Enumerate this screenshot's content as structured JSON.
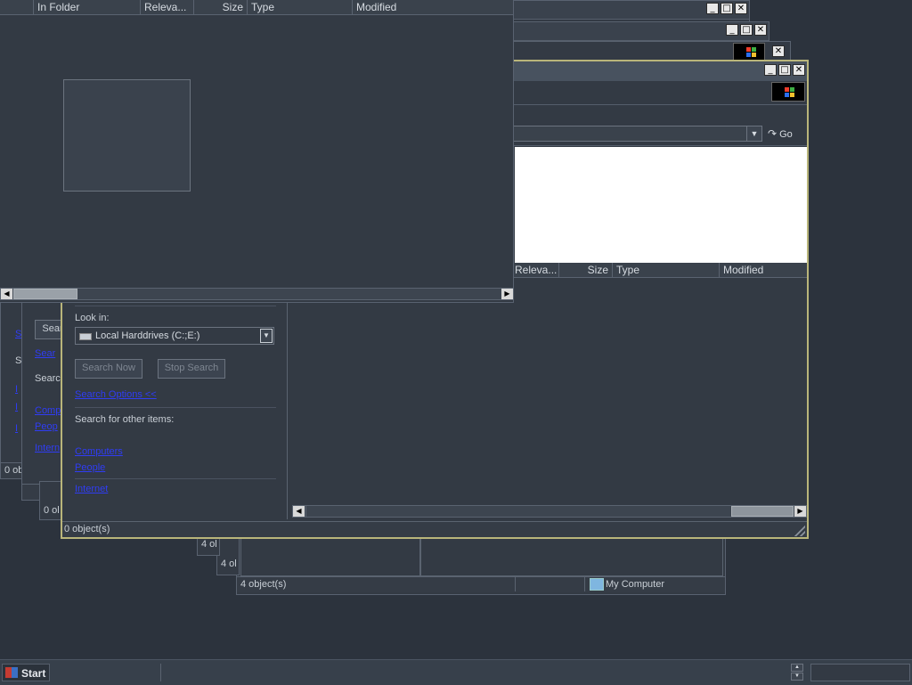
{
  "top_window": {
    "columns": [
      "In Folder",
      "Releva...",
      "Size",
      "Type",
      "Modified"
    ]
  },
  "main_window": {
    "go_label": "Go",
    "columns": [
      "Releva...",
      "Size",
      "Type",
      "Modified"
    ],
    "look_in_label": "Look in:",
    "look_in_value": "Local Harddrives (C:;E:)",
    "search_now": "Search Now",
    "stop_search": "Stop Search",
    "search_options": "Search Options <<",
    "other_items_label": "Search for other items:",
    "links": [
      "Computers",
      "People",
      "Internet"
    ],
    "status": "0 object(s)"
  },
  "background_windows": {
    "status_objects": "4 object(s)",
    "status_location": "My Computer",
    "partial_status_a": "0 ob",
    "partial_status_b": "0 ol",
    "partial_status_c": "4 ol",
    "partial_status_d": "4 ol",
    "partial_search_btn": "Sear",
    "partial_search_label": "Searc",
    "partial_s": "S"
  },
  "taskbar": {
    "start_label": "Start"
  }
}
